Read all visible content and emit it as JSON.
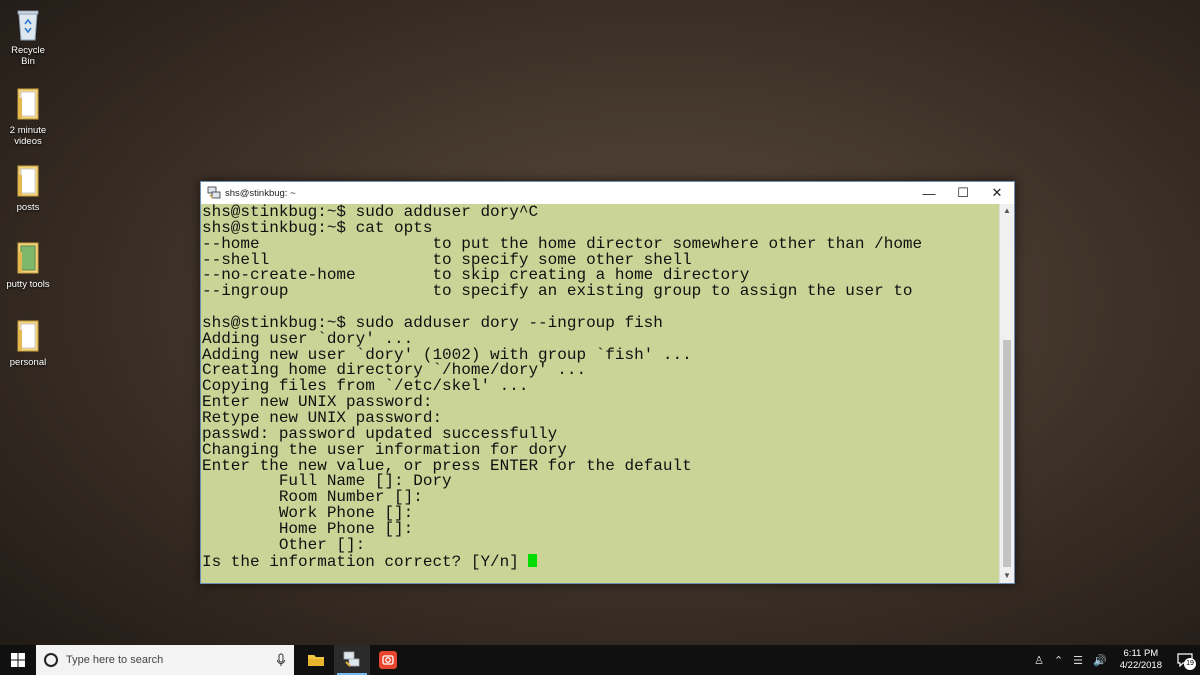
{
  "desktop": {
    "icons": [
      {
        "label": "Recycle Bin",
        "icon": "recycle-bin-icon"
      },
      {
        "label": "2 minute\nvideos",
        "icon": "folder-icon"
      },
      {
        "label": "posts",
        "icon": "folder-icon"
      },
      {
        "label": "putty tools",
        "icon": "folder-icon"
      },
      {
        "label": "personal",
        "icon": "folder-icon"
      }
    ]
  },
  "window": {
    "title": "shs@stinkbug: ~",
    "minimize": "—",
    "maximize": "☐",
    "close": "✕"
  },
  "terminal": {
    "lines": [
      "shs@stinkbug:~$ sudo adduser dory^C",
      "shs@stinkbug:~$ cat opts",
      "--home                  to put the home director somewhere other than /home",
      "--shell                 to specify some other shell",
      "--no-create-home        to skip creating a home directory",
      "--ingroup               to specify an existing group to assign the user to",
      "",
      "shs@stinkbug:~$ sudo adduser dory --ingroup fish",
      "Adding user `dory' ...",
      "Adding new user `dory' (1002) with group `fish' ...",
      "Creating home directory `/home/dory' ...",
      "Copying files from `/etc/skel' ...",
      "Enter new UNIX password:",
      "Retype new UNIX password:",
      "passwd: password updated successfully",
      "Changing the user information for dory",
      "Enter the new value, or press ENTER for the default",
      "        Full Name []: Dory",
      "        Room Number []:",
      "        Work Phone []:",
      "        Home Phone []:",
      "        Other []:"
    ],
    "prompt_line": "Is the information correct? [Y/n] ",
    "cursor_color": "#00dd00",
    "background_color": "#c9d496"
  },
  "taskbar": {
    "search_placeholder": "Type here to search",
    "apps": [
      {
        "name": "file-explorer",
        "icon": "folder-icon",
        "active": false
      },
      {
        "name": "putty",
        "icon": "putty-icon",
        "active": true
      },
      {
        "name": "recorder",
        "icon": "camera-icon",
        "active": false
      }
    ],
    "clock_time": "6:11 PM",
    "clock_date": "4/22/2018",
    "notification_count": "19"
  }
}
